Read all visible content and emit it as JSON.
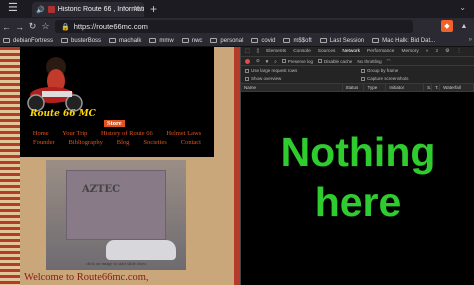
{
  "browser": {
    "tab_title": "Historic Route 66 , Information",
    "new_tab_icon": "+",
    "url": "https://route66mc.com",
    "bookmarks": [
      "debianFortress",
      "busterBoss",
      "machalk",
      "mmw",
      "nwc",
      "personal",
      "covid",
      "m$$oft",
      "Last Session",
      "Mac Halk: Bid Dat..."
    ]
  },
  "page": {
    "logo_text": "Route 66 MC",
    "nav_row1": [
      "Home",
      "Your Trip",
      "History of Route 66",
      "Helmet Laws"
    ],
    "store": "Store",
    "nav_row2": [
      "Founder",
      "Bibliography",
      "Blog",
      "Societies",
      "Contact"
    ],
    "photo_sign": "AZTEC",
    "caption": "click on image to start slide show",
    "welcome": "Welcome to Route66mc.com,"
  },
  "devtools": {
    "tabs": [
      "Elements",
      "Console",
      "Sources",
      "Network",
      "Performance",
      "Memory"
    ],
    "active_tab": "Network",
    "badges": "2",
    "toolbar": {
      "preserve_log": "Preserve log",
      "disable_cache": "Disable cache",
      "throttling": "No throttling"
    },
    "options": {
      "large_rows": "Use large request rows",
      "group_frame": "Group by frame",
      "overview": "Show overview",
      "screenshots": "Capture screenshots"
    },
    "columns": [
      "Name",
      "Status",
      "Type",
      "Initiator",
      "S...",
      "T...",
      "Waterfall"
    ],
    "overlay_line1": "Nothing",
    "overlay_line2": "here"
  },
  "colors": {
    "overlay": "#2ecc2e",
    "nav_link": "#e0551f",
    "welcome": "#8b1a12"
  }
}
